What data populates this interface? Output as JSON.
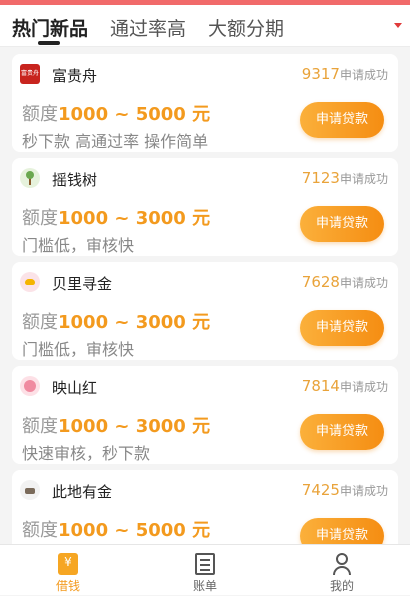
{
  "tabs": [
    {
      "label": "热门新品",
      "active": true
    },
    {
      "label": "通过率高",
      "active": false
    },
    {
      "label": "大额分期",
      "active": false
    }
  ],
  "accent_color": "#f39a1e",
  "products": [
    {
      "name": "富贵舟",
      "logo_text": "富贵舟",
      "count": "9317",
      "status": "申请成功",
      "amount_label": "额度",
      "amount": "1000 ~ 5000 元",
      "desc": "秒下款 高通过率 操作简单",
      "button": "申请贷款"
    },
    {
      "name": "摇钱树",
      "count": "7123",
      "status": "申请成功",
      "amount_label": "额度",
      "amount": "1000 ~ 3000 元",
      "desc": "门槛低，审核快",
      "button": "申请贷款"
    },
    {
      "name": "贝里寻金",
      "count": "7628",
      "status": "申请成功",
      "amount_label": "额度",
      "amount": "1000 ~ 3000 元",
      "desc": "门槛低，审核快",
      "button": "申请贷款"
    },
    {
      "name": "映山红",
      "count": "7814",
      "status": "申请成功",
      "amount_label": "额度",
      "amount": "1000 ~ 3000 元",
      "desc": "快速审核，秒下款",
      "button": "申请贷款"
    },
    {
      "name": "此地有金",
      "count": "7425",
      "status": "申请成功",
      "amount_label": "额度",
      "amount": "1000 ~ 5000 元",
      "desc": "",
      "button": "申请贷款"
    }
  ],
  "bottom_nav": [
    {
      "label": "借钱",
      "icon": "loan-icon",
      "active": true
    },
    {
      "label": "账单",
      "icon": "bill-icon",
      "active": false
    },
    {
      "label": "我的",
      "icon": "user-icon",
      "active": false
    }
  ]
}
